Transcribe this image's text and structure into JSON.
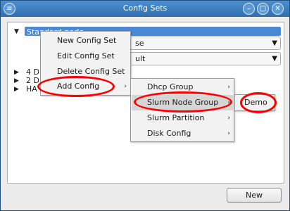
{
  "window": {
    "title": "Config Sets",
    "menu_icon": "menu-icon",
    "minimize_icon": "minimize-icon",
    "maximize_icon": "maximize-icon",
    "close_icon": "close-icon"
  },
  "tree": {
    "selected_label": "Standard node",
    "rows": [
      {
        "label": "4 D"
      },
      {
        "label": "2 D"
      },
      {
        "label": "HA"
      }
    ]
  },
  "combos": [
    {
      "value": "se"
    },
    {
      "value": "ult"
    }
  ],
  "context_menu": {
    "items": [
      {
        "label": "New Config Set"
      },
      {
        "label": "Edit Config Set"
      },
      {
        "label": "Delete Config Set"
      },
      {
        "label": "Add Config",
        "arrow": "›"
      }
    ]
  },
  "submenu": {
    "items": [
      {
        "label": "Dhcp Group",
        "arrow": "›"
      },
      {
        "label": "Slurm Node Group",
        "arrow": "›"
      },
      {
        "label": "Slurm Partition",
        "arrow": "›"
      },
      {
        "label": "Disk Config",
        "arrow": "›"
      }
    ]
  },
  "subsubmenu": {
    "items": [
      {
        "label": "Demo"
      }
    ]
  },
  "buttons": {
    "new_label": "New"
  },
  "annotation_color": "#ff0000"
}
